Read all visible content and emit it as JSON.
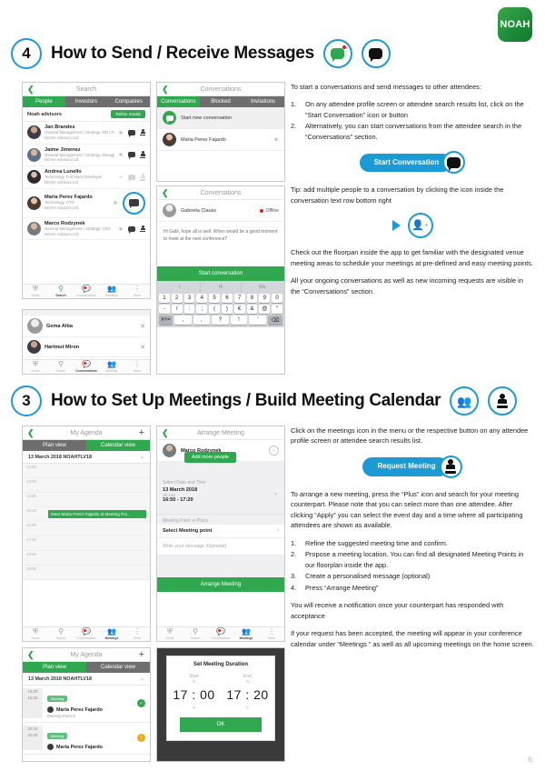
{
  "brand": {
    "logo_text": "NOAH"
  },
  "page_number": "6",
  "section4": {
    "number": "4",
    "title": "How to Send / Receive Messages",
    "intro": "To start a conversations and send messages to other attendees:",
    "steps": [
      {
        "n": "1.",
        "text": "On any attendee profile screen or attendee search results list, click on the “Start Conversation” icon or button"
      },
      {
        "n": "2.",
        "text": "Alternatively, you can start conversations from the attendee search in the “Conversations” section."
      }
    ],
    "cta_label": "Start Conversation",
    "tip": "Tip: add multiple people to a conversation by clicking the icon inside the conversation text row bottom right",
    "para_floorplan": "Check out the floorpan inside the app to get familiar with the designated venue meeting areas to schedule your meetings at pre-defined and easy meeting points.",
    "para_ongoing": "All your ongoing conversations as well as new incoming requests are visible in the “Conversations” section.",
    "search_screen": {
      "title": "Search",
      "tabs": [
        "People",
        "Investors",
        "Companies"
      ],
      "list_label": "Noah advisors",
      "refine_button": "Refine results",
      "people": [
        {
          "name": "Jan Brandes",
          "role": "General Management / Strategy, MD | Partner",
          "company": "NOAH Advisors Ltd"
        },
        {
          "name": "Jaime Jimenez",
          "role": "General Management / Strategy, Managing Direct...",
          "company": "NOAH Advisors Ltd"
        },
        {
          "name": "Andrea Lunello",
          "role": "Technology, Full Stack Developer",
          "company": "NOAH Advisors Ltd"
        },
        {
          "name": "Maria Perez Fajardo",
          "role": "Technology, CTO",
          "company": "NOAH Advisors Ltd"
        },
        {
          "name": "Marco Rodzynek",
          "role": "General Management / Strategy, CEO",
          "company": "NOAH Advisors Ltd"
        }
      ]
    },
    "nav": [
      "Home",
      "Search",
      "Conversations",
      "Meetings",
      "More"
    ],
    "search_results_extra": {
      "people": [
        {
          "name": "Gema Alba"
        },
        {
          "name": "Hartmut Miron"
        }
      ]
    },
    "conversations_screen": {
      "title": "Conversations",
      "tabs": [
        "Conversations",
        "Blocked",
        "Invitations"
      ],
      "start_new": "Start new conversation",
      "thread_name": "Maria Perez Fajardo"
    },
    "chat_screen": {
      "title": "Conversations",
      "contact": "Gabriela Clauss",
      "status": "Offline",
      "message": "Hi Gabi, hope all is well. When would be a good moment to meet at the next conference?",
      "send_button": "Start conversation",
      "keyboard": {
        "suggestions": [
          "I",
          "Hi",
          "We"
        ],
        "row1": [
          "1",
          "2",
          "3",
          "4",
          "5",
          "6",
          "7",
          "8",
          "9",
          "0"
        ],
        "row2": [
          "-",
          "/",
          ":",
          ";",
          "(",
          ")",
          "€",
          "&",
          "@",
          "\""
        ],
        "row3": [
          "#+=",
          ",",
          ",",
          "?",
          "!",
          "'",
          "⌫"
        ]
      }
    }
  },
  "section3": {
    "number": "3",
    "title": "How to Set Up Meetings / Build Meeting Calendar",
    "intro": "Click on the meetings icon in the menu or the respective button on any attendee profile screen or attendee search results list.",
    "cta_label": "Request Meeting",
    "para_arrange": "To arrange a new meeting, press the “Plus” icon and search for your meeting counterpart. Please note that you can select more than one attendee. After clicking “Apply” you can select the event day and a time where all participating attendees are shown as available.",
    "steps": [
      {
        "n": "1.",
        "text": "Refine the suggested meeting time and confirm."
      },
      {
        "n": "2.",
        "text": "Propose a meeting location. You can find all designated Meeting Points in our floorplan inside the app."
      },
      {
        "n": "3.",
        "text": "Create a personalised message (optional)"
      },
      {
        "n": "4.",
        "text": "Press “Arrange Meeting”"
      }
    ],
    "para_notify": "You will receive a notification once your counterpart has responded with acceptance",
    "para_accepted": "If your request has been accepted, the meeting will appear in your conference calendar under “Meetings ” as well as all upcoming meetings on the home screen.",
    "agenda_screen": {
      "title": "My Agenda",
      "tabs": [
        "Plan view",
        "Calendar view"
      ],
      "active_tab": "Calendar view",
      "date": "13 March 2018 NOAHTLV18",
      "slots": [
        "12:00",
        "13:00",
        "14:00",
        "15:00",
        "16:00",
        "17:00",
        "18:00",
        "19:00"
      ],
      "event": "Meet Maria Perez Fajardo at Meeting Poi...",
      "event_slot_index": 3
    },
    "arrange_screen": {
      "title": "Arrange Meeting",
      "person": "Marco Rodzynek",
      "add_more": "Add more people",
      "date_label": "Select Date and Time",
      "date_value": "13 March 2018",
      "day_sub": "Tel Aviv",
      "time_value": "16:50 - 17:20",
      "place_label": "Meeting Point or Place",
      "place_value": "Select Meeting point",
      "message_placeholder": "Write your message (Optional)",
      "submit": "Arrange Meeting"
    },
    "plan_screen": {
      "title": "My Agenda",
      "tabs": [
        "Plan view",
        "Calendar view"
      ],
      "active_tab": "Plan view",
      "date": "13 March 2018 NOAHTLV18",
      "rows": [
        {
          "start": "15:20",
          "end": "15:25",
          "tag": "Meeting",
          "name": "Maria Perez Fajardo",
          "location": "Meeting Point E",
          "status": "accepted"
        },
        {
          "start": "20:15",
          "end": "20:20",
          "tag": "Meeting",
          "name": "Maria Perez Fajardo",
          "location": "",
          "status": "pending"
        }
      ]
    },
    "duration_dialog": {
      "title": "Set Meeting Duration",
      "start_label": "Start",
      "end_label": "End",
      "start_time": "17 : 00",
      "end_time": "17 : 20",
      "ok": "OK"
    },
    "nav": [
      "Home",
      "Search",
      "Conversations",
      "Meetings",
      "More"
    ]
  },
  "colors": {
    "green": "#2fa84f",
    "blue": "#1c9ad6",
    "gray": "#6e6e6e",
    "red": "#e02020",
    "amber": "#f0a91e"
  }
}
